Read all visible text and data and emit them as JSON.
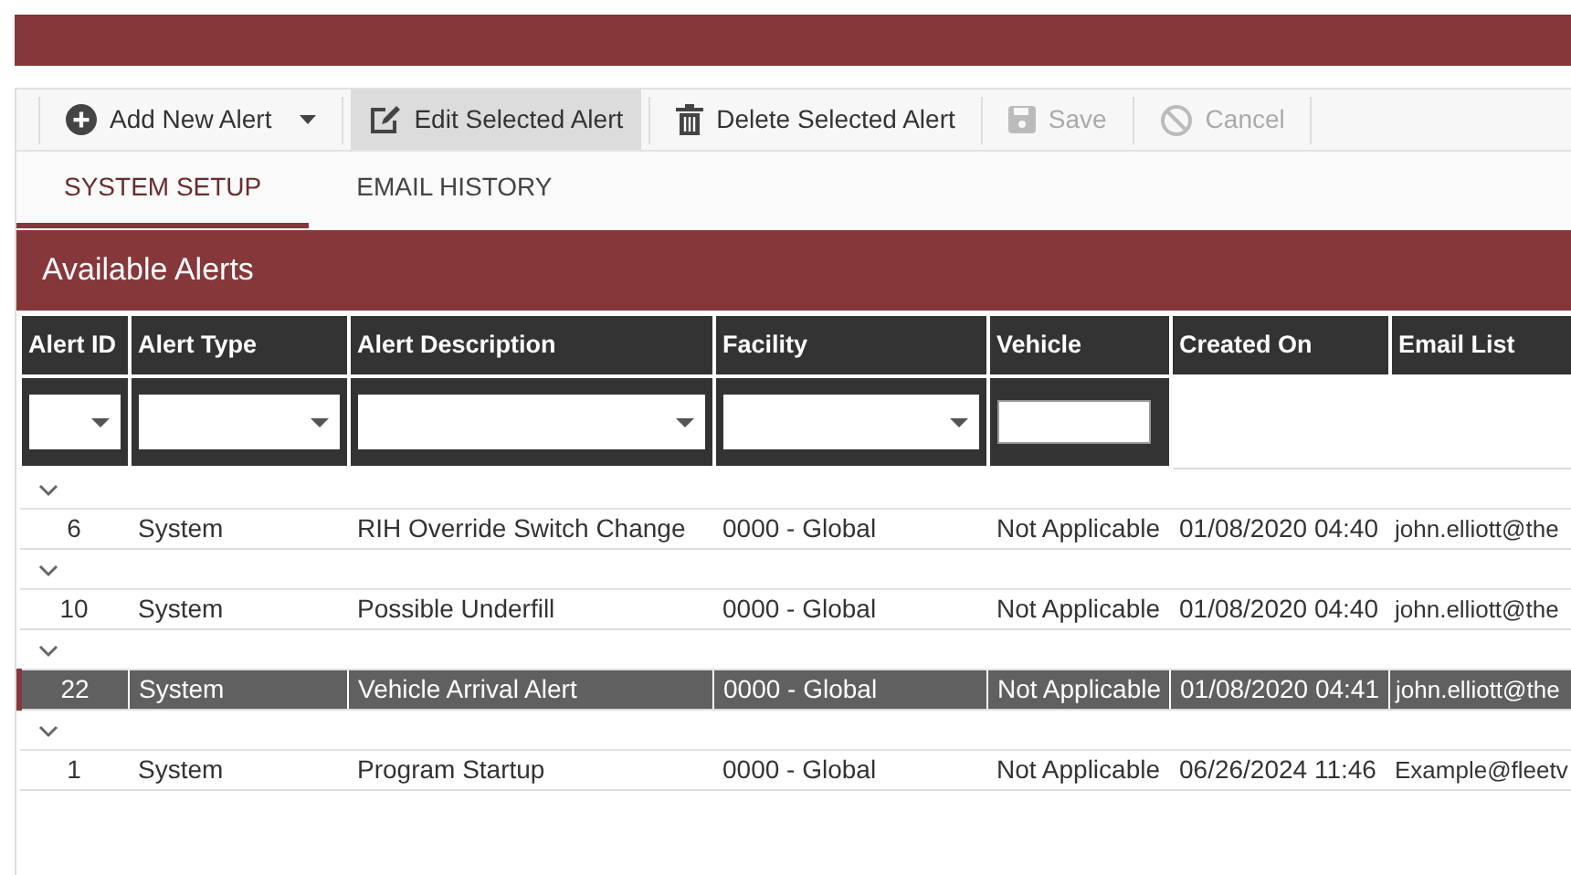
{
  "toolbar": [
    {
      "kind": "add",
      "label": "Add New Alert",
      "dropdown": true,
      "pressed": false,
      "disabled": false
    },
    {
      "kind": "edit",
      "label": "Edit Selected Alert",
      "dropdown": false,
      "pressed": true,
      "disabled": false
    },
    {
      "kind": "delete",
      "label": "Delete Selected Alert",
      "dropdown": false,
      "pressed": false,
      "disabled": false
    },
    {
      "kind": "save",
      "label": "Save",
      "dropdown": false,
      "pressed": false,
      "disabled": true
    },
    {
      "kind": "cancel",
      "label": "Cancel",
      "dropdown": false,
      "pressed": false,
      "disabled": true
    }
  ],
  "tabs": [
    {
      "label": "SYSTEM SETUP",
      "selected": true
    },
    {
      "label": "EMAIL HISTORY",
      "selected": false
    }
  ],
  "section_title": "Available Alerts",
  "table": {
    "columns": [
      {
        "label": "Alert ID",
        "kind": "dropdown"
      },
      {
        "label": "Alert Type",
        "kind": "dropdown"
      },
      {
        "label": "Alert Description",
        "kind": "dropdown"
      },
      {
        "label": "Facility",
        "kind": "dropdown"
      },
      {
        "label": "Vehicle",
        "kind": "text"
      },
      {
        "label": "Created On",
        "kind": "none"
      },
      {
        "label": "Email List",
        "kind": "none"
      }
    ],
    "rows": [
      {
        "selected": false,
        "cells": [
          "6",
          "System",
          "RIH Override Switch Change",
          "0000 - Global",
          "Not Applicable",
          "01/08/2020 04:40",
          "john.elliott@the"
        ]
      },
      {
        "selected": false,
        "cells": [
          "10",
          "System",
          "Possible Underfill",
          "0000 - Global",
          "Not Applicable",
          "01/08/2020 04:40",
          "john.elliott@the"
        ]
      },
      {
        "selected": true,
        "cells": [
          "22",
          "System",
          "Vehicle Arrival Alert",
          "0000 - Global",
          "Not Applicable",
          "01/08/2020 04:41",
          "john.elliott@the"
        ]
      },
      {
        "selected": false,
        "cells": [
          "1",
          "System",
          "Program Startup",
          "0000 - Global",
          "Not Applicable",
          "06/26/2024 11:46",
          "Example@fleetv"
        ]
      }
    ]
  }
}
